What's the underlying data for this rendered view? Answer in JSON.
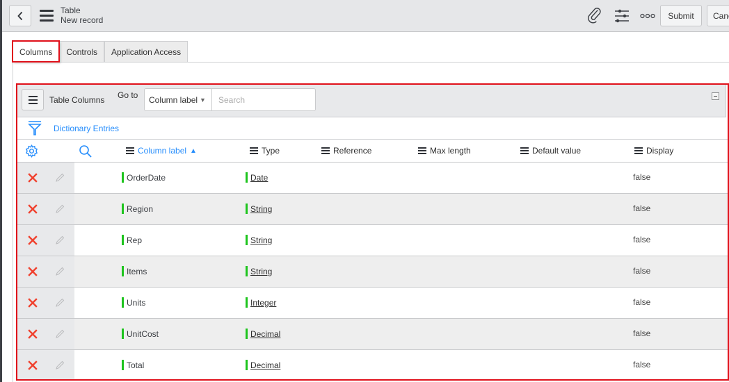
{
  "header": {
    "title": "Table",
    "subtitle": "New record",
    "icons": [
      "chevron-left-icon",
      "hamburger-menu-icon",
      "paperclip-icon",
      "sliders-icon",
      "more-options-icon"
    ],
    "submit_label": "Submit",
    "cancel_label": "Cancel"
  },
  "tabs": [
    {
      "label": "Columns",
      "active": true
    },
    {
      "label": "Controls",
      "active": false
    },
    {
      "label": "Application Access",
      "active": false
    }
  ],
  "related_list": {
    "title": "Table Columns",
    "goto_label": "Go to",
    "goto_select_value": "Column label",
    "search_placeholder": "Search",
    "filter_link": "Dictionary Entries",
    "columns": [
      {
        "label": "Column label",
        "sorted": "ascending"
      },
      {
        "label": "Type"
      },
      {
        "label": "Reference"
      },
      {
        "label": "Max length"
      },
      {
        "label": "Default value"
      },
      {
        "label": "Display"
      }
    ],
    "rows": [
      {
        "column_label": "OrderDate",
        "type": "Date",
        "reference": "",
        "max_length": "",
        "default_value": "",
        "display": "false"
      },
      {
        "column_label": "Region",
        "type": "String",
        "reference": "",
        "max_length": "",
        "default_value": "",
        "display": "false"
      },
      {
        "column_label": "Rep",
        "type": "String",
        "reference": "",
        "max_length": "",
        "default_value": "",
        "display": "false"
      },
      {
        "column_label": "Items",
        "type": "String",
        "reference": "",
        "max_length": "",
        "default_value": "",
        "display": "false"
      },
      {
        "column_label": "Units",
        "type": "Integer",
        "reference": "",
        "max_length": "",
        "default_value": "",
        "display": "false"
      },
      {
        "column_label": "UnitCost",
        "type": "Decimal",
        "reference": "",
        "max_length": "",
        "default_value": "",
        "display": "false"
      },
      {
        "column_label": "Total",
        "type": "Decimal",
        "reference": "",
        "max_length": "",
        "default_value": "",
        "display": "false"
      }
    ]
  },
  "colors": {
    "accent_blue": "#278efc",
    "highlight_red": "#e0101a",
    "mandatory_green": "#1ec41e",
    "delete_red": "#f0412e"
  }
}
